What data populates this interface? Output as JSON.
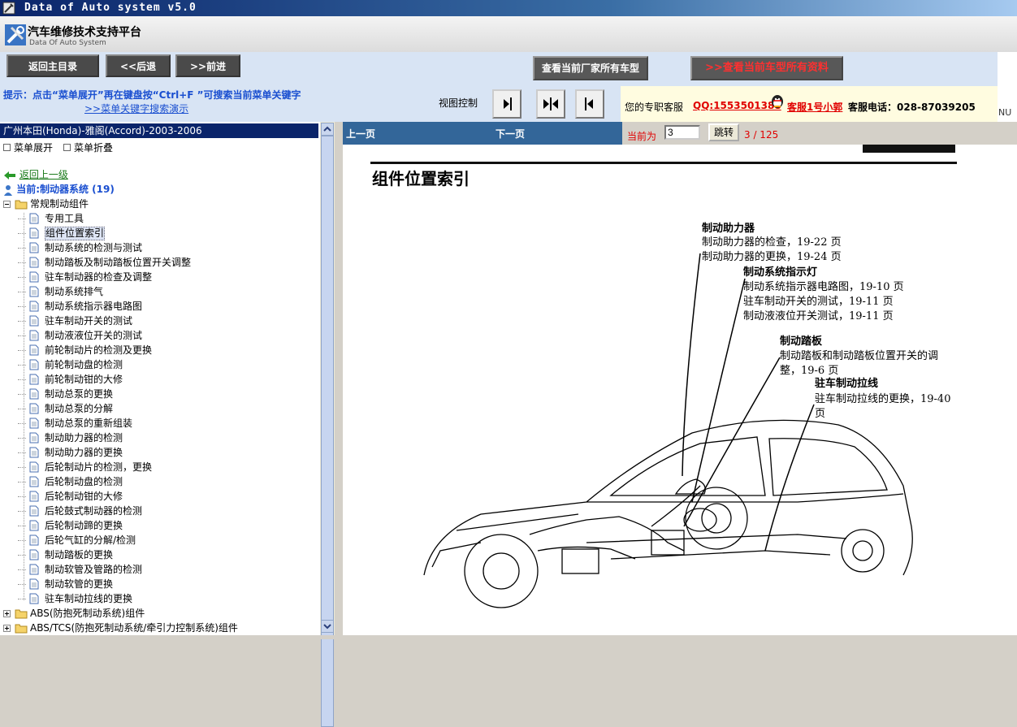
{
  "window": {
    "title": "Data of Auto system v5.0"
  },
  "header": {
    "title": "汽车维修技术支持平台",
    "subtitle": "Data Of Auto System"
  },
  "nav": {
    "main_menu": "返回主目录",
    "back": "<<后退",
    "forward": ">>前进",
    "all_models": "查看当前厂家所有车型",
    "all_data": ">>查看当前车型所有资料"
  },
  "hint": {
    "text": "提示：点击“菜单展开”再在键盘按“Ctrl+F ”可搜索当前菜单关键字",
    "link": ">>菜单关键字搜索演示",
    "view_control": "视图控制"
  },
  "service": {
    "label": "您的专职客服",
    "qq": "QQ:1553501388",
    "agent": "客服1号小郭",
    "phone": "客服电话：028-87039205",
    "edge_text": "NU"
  },
  "tree": {
    "header": "广州本田(Honda)-雅阁(Accord)-2003-2006",
    "expand": "菜单展开",
    "collapse": "菜单折叠",
    "back_up": "返回上一级",
    "current": "当前:制动器系统 (19)",
    "group": "常规制动组件",
    "items": [
      "专用工具",
      "组件位置索引",
      "制动系统的检测与测试",
      "制动踏板及制动踏板位置开关调整",
      "驻车制动器的检查及调整",
      "制动系统排气",
      "制动系统指示器电路图",
      "驻车制动开关的测试",
      "制动液液位开关的测试",
      "前轮制动片的检测及更换",
      "前轮制动盘的检测",
      "前轮制动钳的大修",
      "制动总泵的更换",
      "制动总泵的分解",
      "制动总泵的重新组装",
      "制动助力器的检测",
      "制动助力器的更换",
      "后轮制动片的检测，更换",
      "后轮制动盘的检测",
      "后轮制动钳的大修",
      "后轮鼓式制动器的检测",
      "后轮制动蹄的更换",
      "后轮气缸的分解/检测",
      "制动踏板的更换",
      "制动软管及管路的检测",
      "制动软管的更换",
      "驻车制动拉线的更换"
    ],
    "selected_index": 1,
    "other_groups": [
      "ABS(防抱死制动系统)组件",
      "ABS/TCS(防抱死制动系统/牵引力控制系统)组件"
    ]
  },
  "pager": {
    "prev": "上一页",
    "next": "下一页",
    "current_label": "当前为",
    "current_value": "3",
    "jump": "跳转",
    "count": "3 / 125"
  },
  "doc": {
    "title": "组件位置索引",
    "sections": [
      {
        "heading": "制动助力器",
        "lines": [
          "制动助力器的检查，19-22 页",
          "制动助力器的更换，19-24 页"
        ]
      },
      {
        "heading": "制动系统指示灯",
        "lines": [
          "制动系统指示器电路图，19-10 页",
          "驻车制动开关的测试，19-11 页",
          "制动液液位开关测试，19-11 页"
        ]
      },
      {
        "heading": "制动踏板",
        "lines": [
          "制动踏板和制动踏板位置开关的调",
          "整，19-6 页"
        ]
      },
      {
        "heading": "驻车制动拉线",
        "lines": [
          "驻车制动拉线的更换，19-40",
          "页"
        ]
      }
    ]
  }
}
